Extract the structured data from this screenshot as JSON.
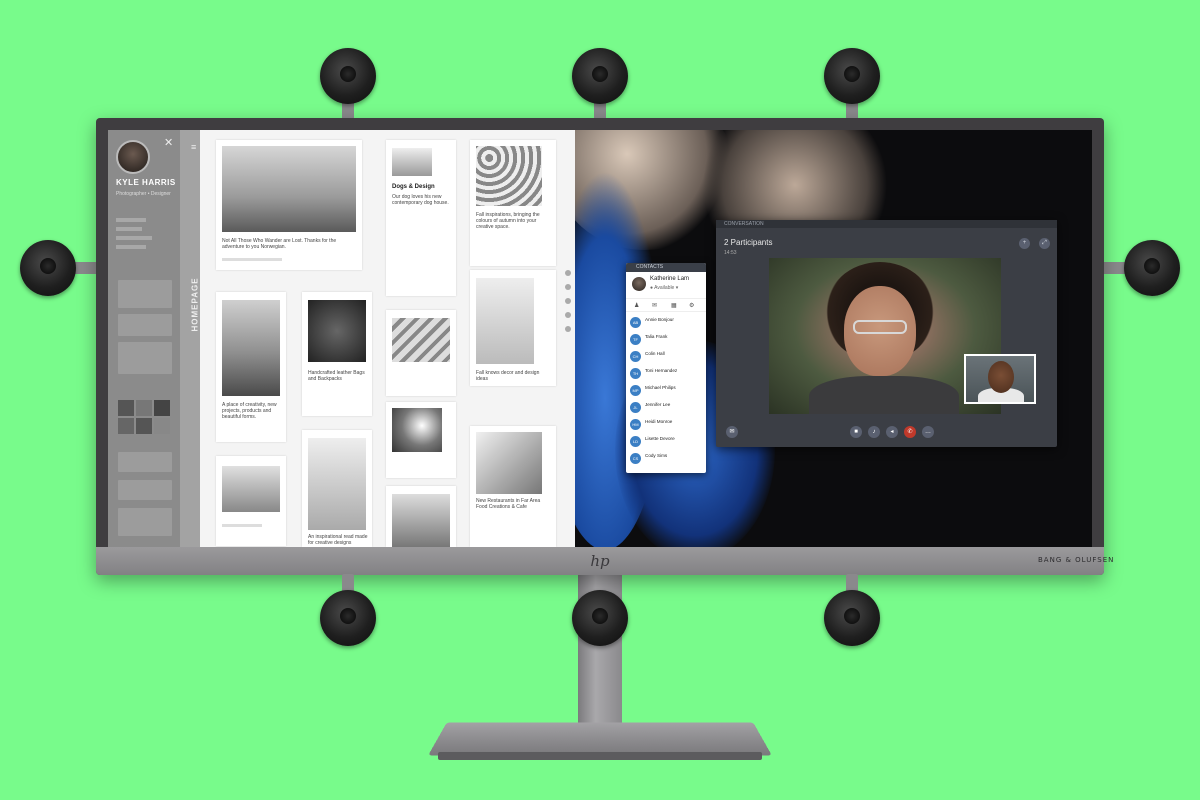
{
  "monitor": {
    "logo": "hp",
    "brand_label": "BANG & OLUFSEN"
  },
  "portfolio": {
    "profile_name": "KYLE HARRIS",
    "tagline": "Photographer • Designer",
    "vertical_tab": "HOMEPAGE",
    "posts": [
      {
        "caption": "Not All Those Who Wander are Lost. Thanks for the adventure to you Norwegian."
      },
      {
        "title": "Dogs & Design",
        "caption": "Our dog loves his new contemporary dog house."
      },
      {
        "caption": "Fall inspirations, bringing the colours of autumn into your creative space."
      },
      {
        "caption": "A place of creativity, new projects, products and beautiful forms."
      },
      {
        "caption": "Handcrafted leather Bags and Backpacks"
      },
      {
        "caption": "Fall knows decor and design ideas"
      },
      {
        "caption": "An inspirational read made for creative designs"
      },
      {
        "caption": "New Restaurants in Far Area Food Creations & Cafe"
      }
    ]
  },
  "contacts": {
    "window_title": "CONTACTS",
    "me": {
      "name": "Katherine Lam",
      "status": "● Available ▾"
    },
    "list": [
      {
        "name": "Annie Bonjour",
        "initials": "AB"
      },
      {
        "name": "Talia Frank",
        "initials": "TF"
      },
      {
        "name": "Colin Hall",
        "initials": "CH"
      },
      {
        "name": "Toni Hernandez",
        "initials": "TH"
      },
      {
        "name": "Michael Philips",
        "initials": "MP"
      },
      {
        "name": "Jennifer Lee",
        "initials": "JL"
      },
      {
        "name": "Heidi Monroe",
        "initials": "HM"
      },
      {
        "name": "Lisette Devore",
        "initials": "LD"
      },
      {
        "name": "Cody Sims",
        "initials": "CS"
      }
    ]
  },
  "conversation": {
    "window_title": "CONVERSATION",
    "title": "2 Participants",
    "timer": "14:53"
  }
}
